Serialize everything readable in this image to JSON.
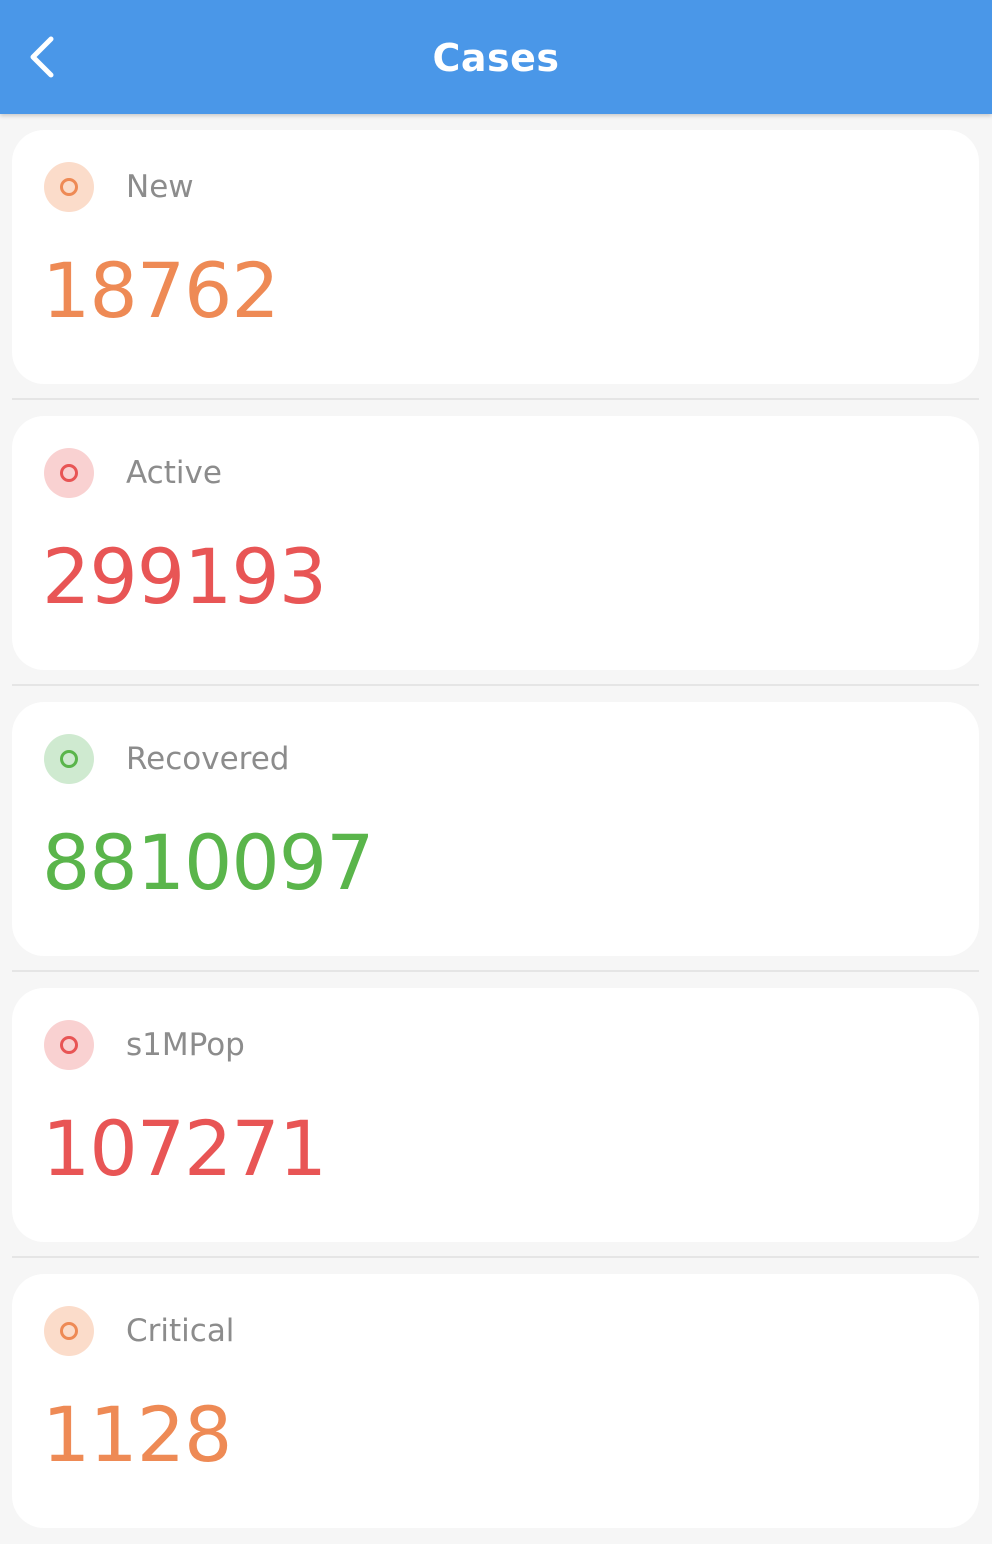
{
  "header": {
    "title": "Cases",
    "back_icon": "chevron-left-icon",
    "background": "#4a97e8"
  },
  "stats": [
    {
      "label": "New",
      "value": "18762",
      "color": "#ee8a55",
      "dot_bg": "#fbdcca"
    },
    {
      "label": "Active",
      "value": "299193",
      "color": "#e85555",
      "dot_bg": "#f9d1d1"
    },
    {
      "label": "Recovered",
      "value": "8810097",
      "color": "#5ab54b",
      "dot_bg": "#cfead0"
    },
    {
      "label": "s1MPop",
      "value": "107271",
      "color": "#e85555",
      "dot_bg": "#f9d1d1"
    },
    {
      "label": "Critical",
      "value": "1128",
      "color": "#ee8a55",
      "dot_bg": "#fbdcca"
    }
  ]
}
